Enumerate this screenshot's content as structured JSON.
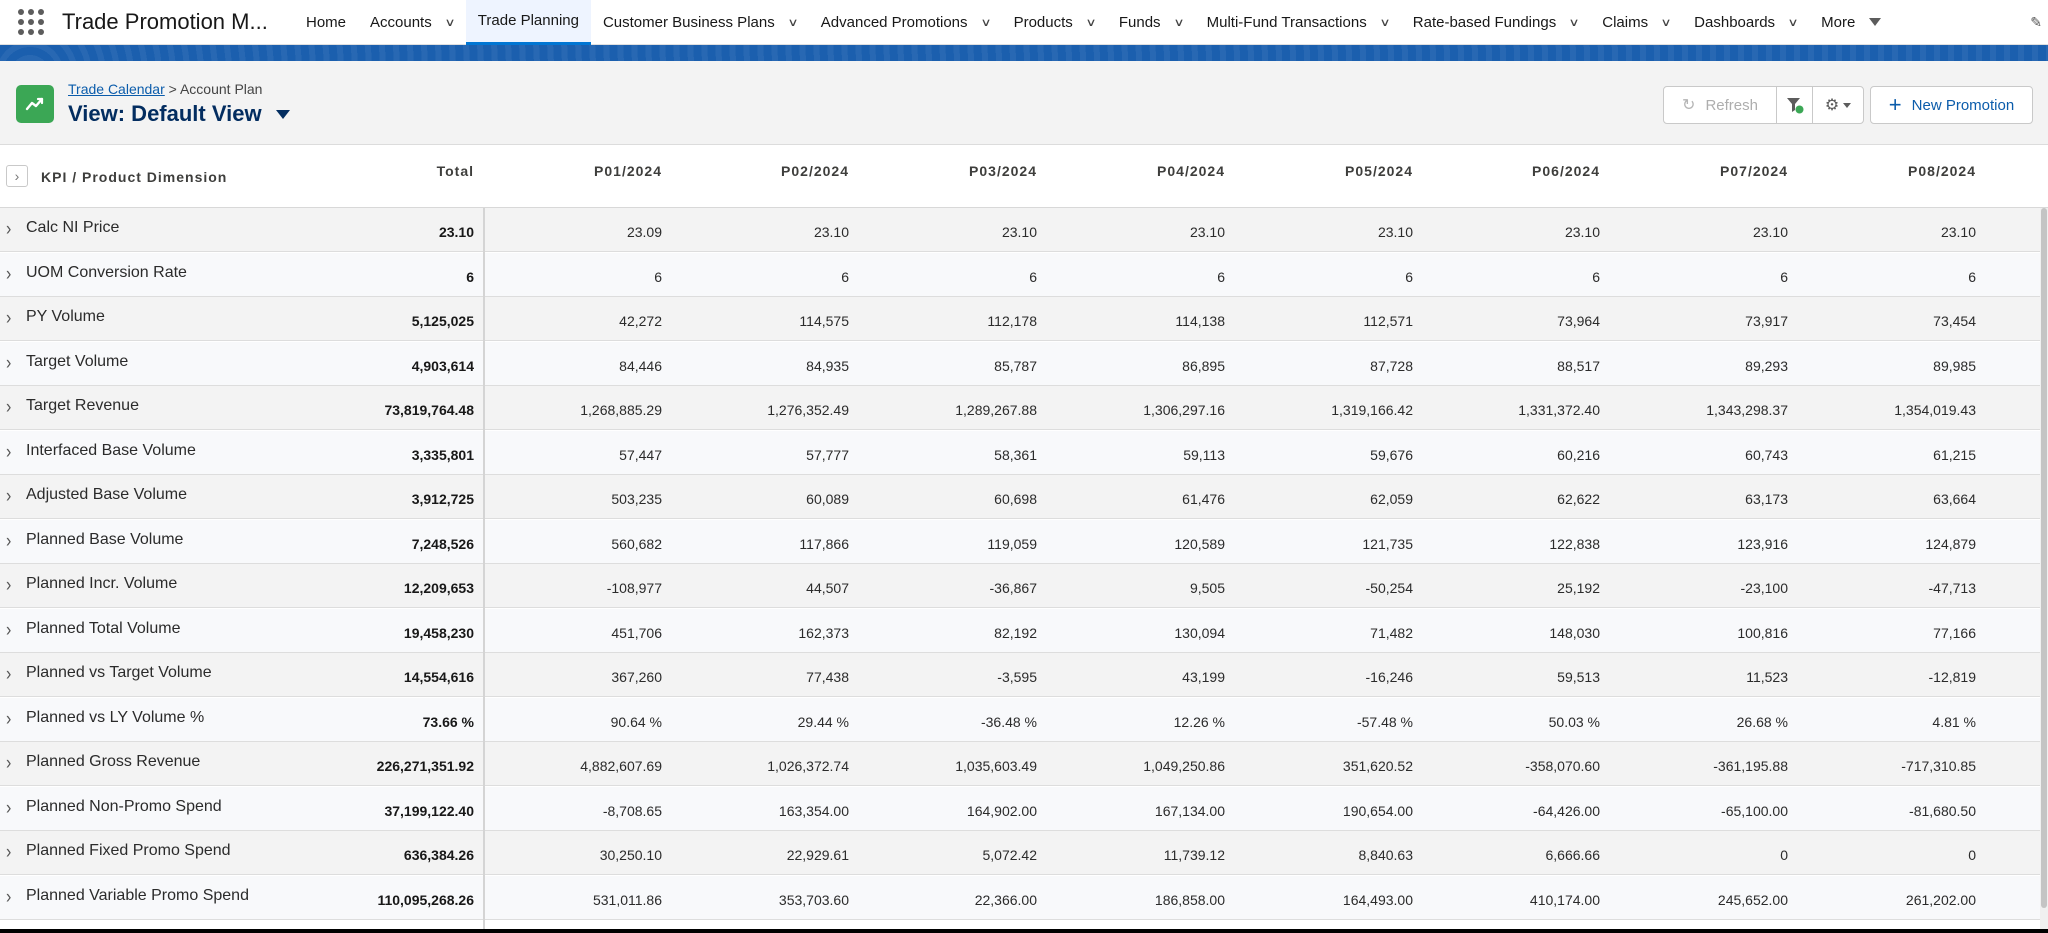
{
  "app": {
    "name": "Trade Promotion M..."
  },
  "nav": {
    "items": [
      {
        "label": "Home",
        "dropdown": false,
        "active": false
      },
      {
        "label": "Accounts",
        "dropdown": true,
        "active": false
      },
      {
        "label": "Trade Planning",
        "dropdown": false,
        "active": true
      },
      {
        "label": "Customer Business Plans",
        "dropdown": true,
        "active": false
      },
      {
        "label": "Advanced Promotions",
        "dropdown": true,
        "active": false
      },
      {
        "label": "Products",
        "dropdown": true,
        "active": false
      },
      {
        "label": "Funds",
        "dropdown": true,
        "active": false
      },
      {
        "label": "Multi-Fund Transactions",
        "dropdown": true,
        "active": false
      },
      {
        "label": "Rate-based Fundings",
        "dropdown": true,
        "active": false
      },
      {
        "label": "Claims",
        "dropdown": true,
        "active": false
      },
      {
        "label": "Dashboards",
        "dropdown": true,
        "active": false
      }
    ],
    "more_label": "More"
  },
  "header": {
    "breadcrumb_link": "Trade Calendar",
    "breadcrumb_sep": ">",
    "breadcrumb_current": "Account Plan",
    "view_title": "View: Default View",
    "refresh_label": "Refresh",
    "new_promotion_label": "New Promotion"
  },
  "colors": {
    "accent": "#0176d3",
    "band": "#1b5fae",
    "icon_green": "#3ba755",
    "title": "#032d60"
  },
  "table": {
    "kpi_header": "KPI / Product Dimension",
    "total_header": "Total",
    "periods": [
      "P01/2024",
      "P02/2024",
      "P03/2024",
      "P04/2024",
      "P05/2024",
      "P06/2024",
      "P07/2024",
      "P08/2024"
    ],
    "rows": [
      {
        "label": "Calc NI Price",
        "total": "23.10",
        "values": [
          "23.09",
          "23.10",
          "23.10",
          "23.10",
          "23.10",
          "23.10",
          "23.10",
          "23.10"
        ]
      },
      {
        "label": "UOM Conversion Rate",
        "total": "6",
        "values": [
          "6",
          "6",
          "6",
          "6",
          "6",
          "6",
          "6",
          "6"
        ]
      },
      {
        "label": "PY Volume",
        "total": "5,125,025",
        "values": [
          "42,272",
          "114,575",
          "112,178",
          "114,138",
          "112,571",
          "73,964",
          "73,917",
          "73,454"
        ]
      },
      {
        "label": "Target Volume",
        "total": "4,903,614",
        "values": [
          "84,446",
          "84,935",
          "85,787",
          "86,895",
          "87,728",
          "88,517",
          "89,293",
          "89,985"
        ]
      },
      {
        "label": "Target Revenue",
        "total": "73,819,764.48",
        "values": [
          "1,268,885.29",
          "1,276,352.49",
          "1,289,267.88",
          "1,306,297.16",
          "1,319,166.42",
          "1,331,372.40",
          "1,343,298.37",
          "1,354,019.43"
        ]
      },
      {
        "label": "Interfaced Base Volume",
        "total": "3,335,801",
        "values": [
          "57,447",
          "57,777",
          "58,361",
          "59,113",
          "59,676",
          "60,216",
          "60,743",
          "61,215"
        ]
      },
      {
        "label": "Adjusted Base Volume",
        "total": "3,912,725",
        "values": [
          "503,235",
          "60,089",
          "60,698",
          "61,476",
          "62,059",
          "62,622",
          "63,173",
          "63,664"
        ]
      },
      {
        "label": "Planned Base Volume",
        "total": "7,248,526",
        "values": [
          "560,682",
          "117,866",
          "119,059",
          "120,589",
          "121,735",
          "122,838",
          "123,916",
          "124,879"
        ]
      },
      {
        "label": "Planned Incr. Volume",
        "total": "12,209,653",
        "values": [
          "-108,977",
          "44,507",
          "-36,867",
          "9,505",
          "-50,254",
          "25,192",
          "-23,100",
          "-47,713"
        ]
      },
      {
        "label": "Planned Total Volume",
        "total": "19,458,230",
        "values": [
          "451,706",
          "162,373",
          "82,192",
          "130,094",
          "71,482",
          "148,030",
          "100,816",
          "77,166"
        ]
      },
      {
        "label": "Planned vs Target Volume",
        "total": "14,554,616",
        "values": [
          "367,260",
          "77,438",
          "-3,595",
          "43,199",
          "-16,246",
          "59,513",
          "11,523",
          "-12,819"
        ]
      },
      {
        "label": "Planned vs LY Volume %",
        "total": "73.66 %",
        "values": [
          "90.64 %",
          "29.44 %",
          "-36.48 %",
          "12.26 %",
          "-57.48 %",
          "50.03 %",
          "26.68 %",
          "4.81 %"
        ]
      },
      {
        "label": "Planned Gross Revenue",
        "total": "226,271,351.92",
        "values": [
          "4,882,607.69",
          "1,026,372.74",
          "1,035,603.49",
          "1,049,250.86",
          "351,620.52",
          "-358,070.60",
          "-361,195.88",
          "-717,310.85"
        ]
      },
      {
        "label": "Planned Non-Promo Spend",
        "total": "37,199,122.40",
        "values": [
          "-8,708.65",
          "163,354.00",
          "164,902.00",
          "167,134.00",
          "190,654.00",
          "-64,426.00",
          "-65,100.00",
          "-81,680.50"
        ]
      },
      {
        "label": "Planned Fixed Promo Spend",
        "total": "636,384.26",
        "values": [
          "30,250.10",
          "22,929.61",
          "5,072.42",
          "11,739.12",
          "8,840.63",
          "6,666.66",
          "0",
          "0"
        ]
      },
      {
        "label": "Planned Variable Promo Spend",
        "total": "110,095,268.26",
        "values": [
          "531,011.86",
          "353,703.60",
          "22,366.00",
          "186,858.00",
          "164,493.00",
          "410,174.00",
          "245,652.00",
          "261,202.00"
        ]
      }
    ]
  }
}
